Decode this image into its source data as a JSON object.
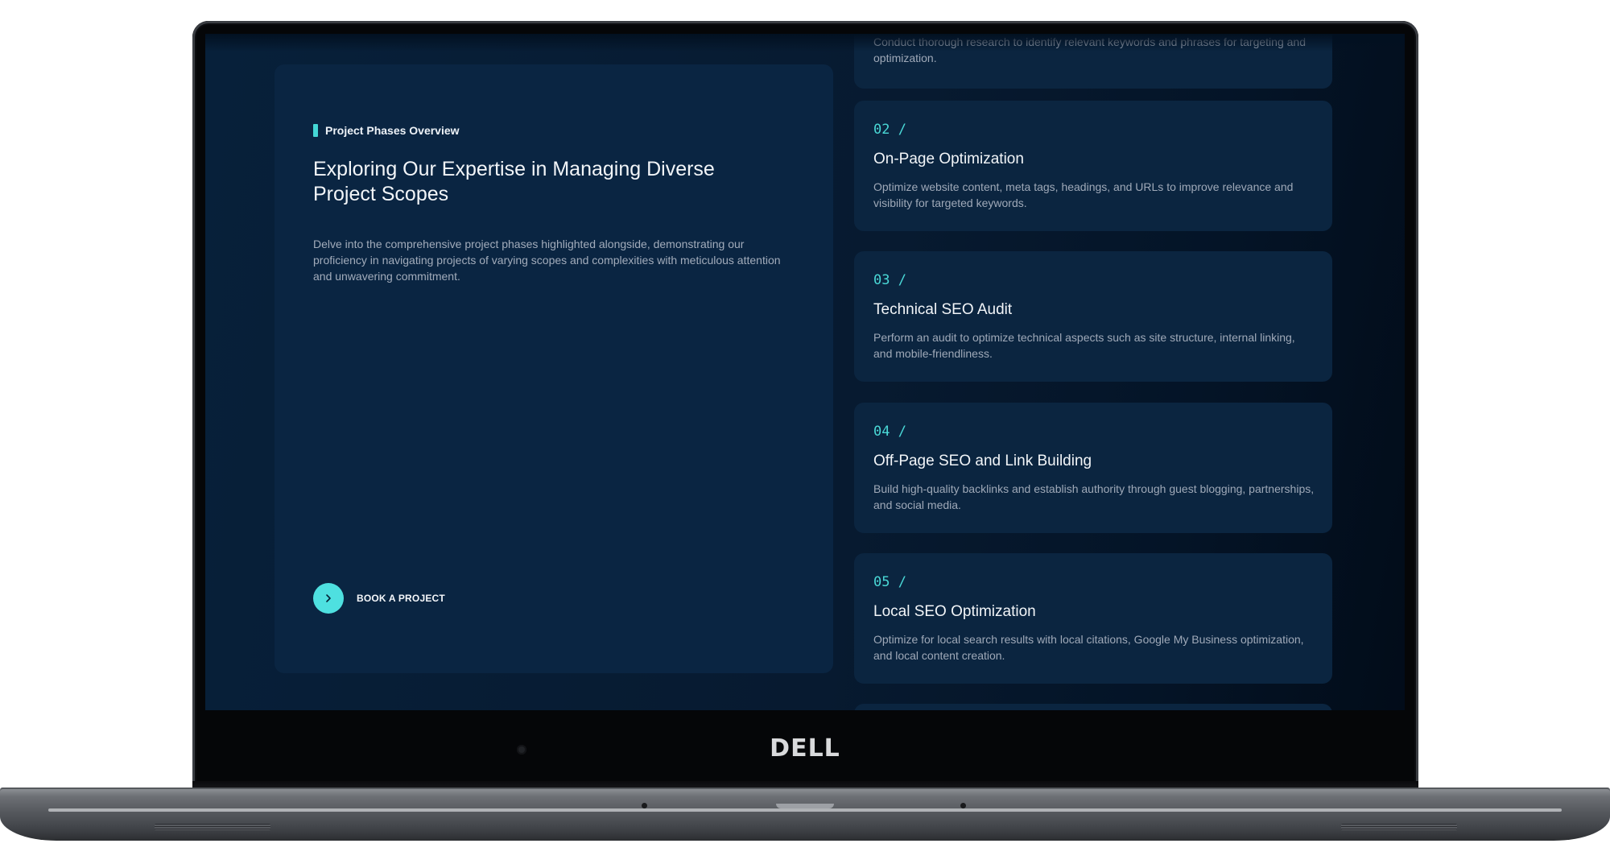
{
  "device": {
    "brand": "DELL"
  },
  "colors": {
    "accent": "#44d7d6",
    "panel": "#0a2542",
    "background": "#06192f"
  },
  "section": {
    "eyebrow": "Project Phases Overview",
    "title": "Exploring Our Expertise in Managing Diverse Project Scopes",
    "description": "Delve into the comprehensive project phases highlighted alongside, demonstrating our proficiency in navigating projects of varying scopes and complexities with meticulous attention and unwavering commitment.",
    "cta_label": "BOOK A PROJECT",
    "cta_icon": "chevron-right-icon"
  },
  "phases": [
    {
      "description": "Conduct thorough research to identify relevant keywords and phrases for targeting and optimization."
    },
    {
      "number": "02 /",
      "title": "On-Page Optimization",
      "description": "Optimize website content, meta tags, headings, and URLs to improve relevance and visibility for targeted keywords."
    },
    {
      "number": "03 /",
      "title": "Technical SEO Audit",
      "description": "Perform an audit to optimize technical aspects such as site structure, internal linking, and mobile-friendliness."
    },
    {
      "number": "04 /",
      "title": "Off-Page SEO and Link Building",
      "description": "Build high-quality backlinks and establish authority through guest blogging, partnerships, and social media."
    },
    {
      "number": "05 /",
      "title": "Local SEO Optimization",
      "description": "Optimize for local search results with local citations, Google My Business optimization, and local content creation."
    }
  ]
}
